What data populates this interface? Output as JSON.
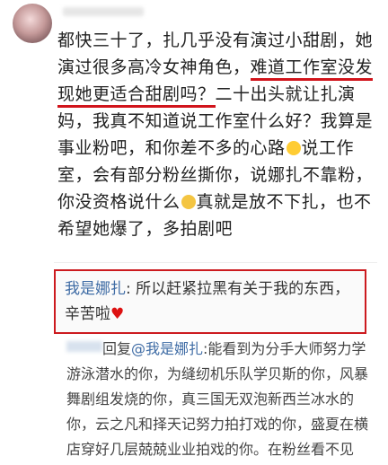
{
  "comment": {
    "text_part1": "都快三十了，扎几乎没有演过小甜剧，她演过很多高冷女神角色，",
    "text_highlight": "难道工作室没发现她更适合甜剧吗？",
    "text_part2": "二十出头就让扎演妈，我真不知道说工作室什么好？我算是事业粉吧，和你差不多的心路",
    "text_part3": "说工作室，会有部分粉丝撕你，说娜扎不靠粉，你没资格说什么",
    "text_part4": "真就是放不下扎，也不希望她爆了，多拍剧吧"
  },
  "reply": {
    "user": "我是娜扎",
    "text": ": 所以赶紧拉黑有关于我的东西，辛苦啦"
  },
  "sub_reply": {
    "prefix": "回复",
    "mention": "@我是娜扎",
    "text": ":能看到为分手大师努力学游泳潜水的你，为缝纫机乐队学贝斯的你，风暴舞剧组发烧的你，真三国无双泡新西兰冰水的你，云之凡和择天记努力拍打戏的你，盛夏在横店穿好几层兢兢业业拍戏的你。在粉丝看不见"
  }
}
